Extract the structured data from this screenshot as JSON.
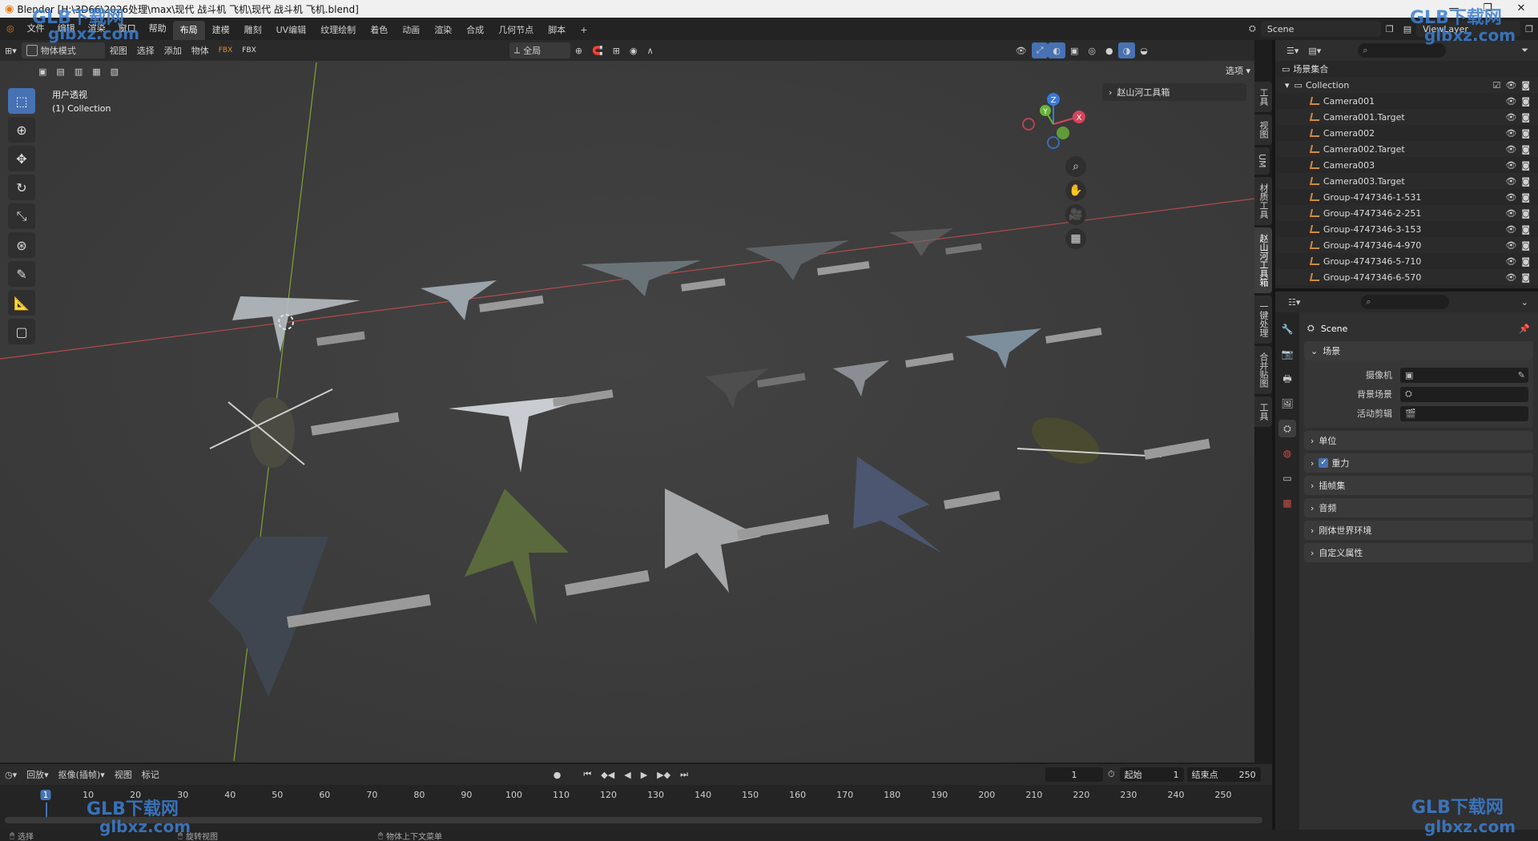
{
  "window": {
    "title": "Blender [H:\\3D66\\2026处理\\max\\现代 战斗机 飞机\\现代 战斗机 飞机.blend]",
    "controls": [
      "—",
      "❐",
      "✕"
    ]
  },
  "menu": [
    "文件",
    "编辑",
    "渲染",
    "窗口",
    "帮助"
  ],
  "workspaces": [
    "布局",
    "建模",
    "雕刻",
    "UV编辑",
    "纹理绘制",
    "着色",
    "动画",
    "渲染",
    "合成",
    "几何节点",
    "脚本",
    "+"
  ],
  "active_workspace": "布局",
  "topright": {
    "scene": "Scene",
    "viewlayer": "ViewLayer"
  },
  "viewport_header": {
    "mode": "物体模式",
    "menus": [
      "视图",
      "选择",
      "添加",
      "物体"
    ],
    "transform": "全局",
    "options": "选项"
  },
  "viewport": {
    "view_name": "用户透视",
    "collection": "(1) Collection",
    "toolbox_panel": "赵山河工具箱",
    "gizmo": {
      "x": "X",
      "y": "Y",
      "z": "Z"
    }
  },
  "sidetabs": [
    "工具",
    "视图",
    "UM",
    "材质工具",
    "赵山河工具箱",
    "一键处理",
    "合并贴图",
    "工具"
  ],
  "active_sidetab": "赵山河工具箱",
  "outliner": {
    "root": "场景集合",
    "collection": "Collection",
    "items": [
      "Camera001",
      "Camera001.Target",
      "Camera002",
      "Camera002.Target",
      "Camera003",
      "Camera003.Target",
      "Group-4747346-1-531",
      "Group-4747346-2-251",
      "Group-4747346-3-153",
      "Group-4747346-4-970",
      "Group-4747346-5-710",
      "Group-4747346-6-570"
    ]
  },
  "properties": {
    "context": "Scene",
    "panels": {
      "scene": {
        "title": "场景",
        "rows": [
          {
            "label": "摄像机",
            "value": ""
          },
          {
            "label": "背景场景",
            "value": ""
          },
          {
            "label": "活动剪辑",
            "value": ""
          }
        ]
      },
      "collapsed": [
        "单位",
        "重力",
        "插帧集",
        "音频",
        "刚体世界环境",
        "自定义属性"
      ]
    }
  },
  "timeline": {
    "menus": [
      "回放",
      "抠像(插帧)",
      "视图",
      "标记"
    ],
    "current_frame": "1",
    "start_label": "起始",
    "start": "1",
    "end_label": "结束点",
    "end": "250",
    "ruler": [
      "1",
      "10",
      "20",
      "30",
      "40",
      "50",
      "60",
      "70",
      "80",
      "90",
      "100",
      "110",
      "120",
      "130",
      "140",
      "150",
      "160",
      "170",
      "180",
      "190",
      "200",
      "210",
      "220",
      "230",
      "240",
      "250"
    ]
  },
  "statusbar": {
    "left": "选择",
    "mid": "旋转视图",
    "right": "物体上下文菜单"
  },
  "watermark": {
    "brand": "GLB下载网",
    "site": "glbxz.com"
  }
}
